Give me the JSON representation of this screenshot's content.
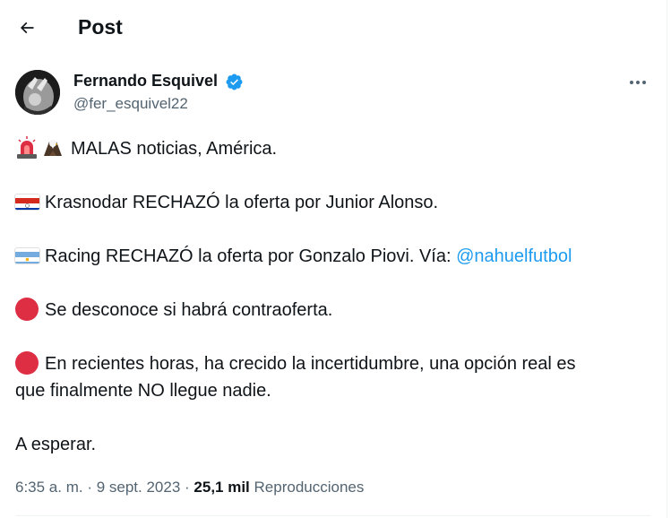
{
  "header": {
    "title": "Post",
    "back_icon": "arrow-left-icon"
  },
  "author": {
    "name": "Fernando Esquivel",
    "handle": "@fer_esquivel22",
    "verified": true
  },
  "tweet": {
    "line1": "MALAS noticias, América.",
    "line2": "Krasnodar RECHAZÓ la oferta por Junior Alonso.",
    "line3_prefix": "Racing RECHAZÓ la oferta por Gonzalo Piovi. Vía: ",
    "line3_mention": "@nahuelfutbol",
    "line4": "Se desconoce si habrá contraoferta.",
    "line5a": "En recientes horas, ha crecido la incertidumbre, una opción real es",
    "line5b": "que finalmente NO llegue nadie.",
    "line6": "A esperar."
  },
  "meta": {
    "time": "6:35 a. m.",
    "separator": " · ",
    "date": "9 sept. 2023",
    "views_count": "25,1 mil",
    "views_label": "Reproducciones"
  },
  "colors": {
    "accent": "#1d9bf0",
    "secondary_text": "#536471",
    "alert_red": "#dd2e44"
  }
}
